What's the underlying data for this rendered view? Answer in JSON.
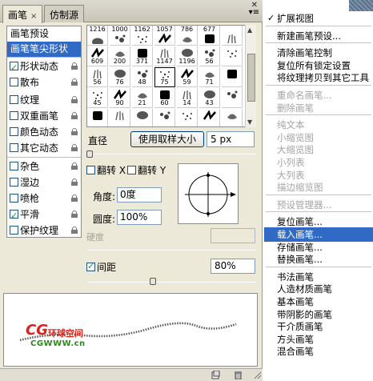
{
  "tabs": [
    {
      "label": "画笔",
      "close": "×"
    },
    {
      "label": "仿制源"
    }
  ],
  "panel_menu_arrow": "▾≡",
  "sidebar": {
    "items": [
      {
        "label": "画笔预设",
        "checkbox": false,
        "lock": false
      },
      {
        "label": "画笔笔尖形状",
        "checkbox": false,
        "lock": false,
        "selected": true
      },
      {
        "label": "形状动态",
        "checkbox": true,
        "checked": true,
        "lock": true
      },
      {
        "label": "散布",
        "checkbox": true,
        "checked": false,
        "lock": true
      },
      {
        "label": "纹理",
        "checkbox": true,
        "checked": false,
        "lock": true
      },
      {
        "label": "双重画笔",
        "checkbox": true,
        "checked": false,
        "lock": true
      },
      {
        "label": "颜色动态",
        "checkbox": true,
        "checked": false,
        "lock": true
      },
      {
        "label": "其它动态",
        "checkbox": true,
        "checked": false,
        "lock": true
      },
      {
        "label": "杂色",
        "checkbox": true,
        "checked": false,
        "lock": true
      },
      {
        "label": "湿边",
        "checkbox": true,
        "checked": false,
        "lock": true
      },
      {
        "label": "喷枪",
        "checkbox": true,
        "checked": false,
        "lock": true
      },
      {
        "label": "平滑",
        "checkbox": true,
        "checked": true,
        "lock": true
      },
      {
        "label": "保护纹理",
        "checkbox": true,
        "checked": false,
        "lock": true
      }
    ]
  },
  "brush_grid": {
    "rows": [
      [
        "1216",
        "1000",
        "1162",
        "1057",
        "786",
        "677",
        ""
      ],
      [
        "609",
        "200",
        "371",
        "1147",
        "1196",
        "56",
        ""
      ],
      [
        "56",
        "76",
        "48",
        "75",
        "59",
        "71",
        ""
      ],
      [
        "45",
        "90",
        "21",
        "60",
        "14",
        "43",
        ""
      ],
      [
        "",
        "",
        "",
        "",
        "",
        "",
        ""
      ]
    ],
    "selected": "75"
  },
  "controls": {
    "diameter_label": "直径",
    "use_sample_size": "使用取样大小",
    "size_value": "5 px",
    "flip_x": "翻转 X",
    "flip_y": "翻转 Y",
    "angle_label": "角度:",
    "angle_value": "0度",
    "roundness_label": "圆度:",
    "roundness_value": "100%",
    "hardness_label": "硬度",
    "spacing_label": "间距",
    "spacing_checked": true,
    "spacing_value": "80%"
  },
  "watermark": {
    "cg": "CG",
    "cn": "环球空间",
    "url": "CGWWW.cn"
  },
  "flyout_menu": [
    {
      "label": "扩展视图",
      "check": "✓",
      "state": "normal"
    },
    {
      "sep": true
    },
    {
      "label": "新建画笔预设...",
      "state": "normal"
    },
    {
      "sep": true
    },
    {
      "label": "清除画笔控制",
      "state": "normal"
    },
    {
      "label": "复位所有锁定设置",
      "state": "normal"
    },
    {
      "label": "将纹理拷贝到其它工具",
      "state": "normal"
    },
    {
      "sep": true
    },
    {
      "label": "重命名画笔...",
      "state": "disabled"
    },
    {
      "label": "删除画笔",
      "state": "disabled"
    },
    {
      "sep": true
    },
    {
      "label": "纯文本",
      "state": "disabled"
    },
    {
      "label": "小缩览图",
      "state": "disabled"
    },
    {
      "label": "大缩览图",
      "state": "disabled"
    },
    {
      "label": "小列表",
      "state": "disabled"
    },
    {
      "label": "大列表",
      "state": "disabled"
    },
    {
      "label": "描边缩览图",
      "state": "disabled"
    },
    {
      "sep": true
    },
    {
      "label": "预设管理器...",
      "state": "disabled"
    },
    {
      "sep": true
    },
    {
      "label": "复位画笔...",
      "state": "normal"
    },
    {
      "label": "载入画笔...",
      "state": "highlighted"
    },
    {
      "label": "存储画笔...",
      "state": "normal"
    },
    {
      "label": "替换画笔...",
      "state": "normal"
    },
    {
      "sep": true
    },
    {
      "label": "书法画笔",
      "state": "normal"
    },
    {
      "label": "人造材质画笔",
      "state": "normal"
    },
    {
      "label": "基本画笔",
      "state": "normal"
    },
    {
      "label": "带阴影的画笔",
      "state": "normal"
    },
    {
      "label": "干介质画笔",
      "state": "normal"
    },
    {
      "label": "方头画笔",
      "state": "normal"
    },
    {
      "label": "混合画笔",
      "state": "normal"
    }
  ]
}
